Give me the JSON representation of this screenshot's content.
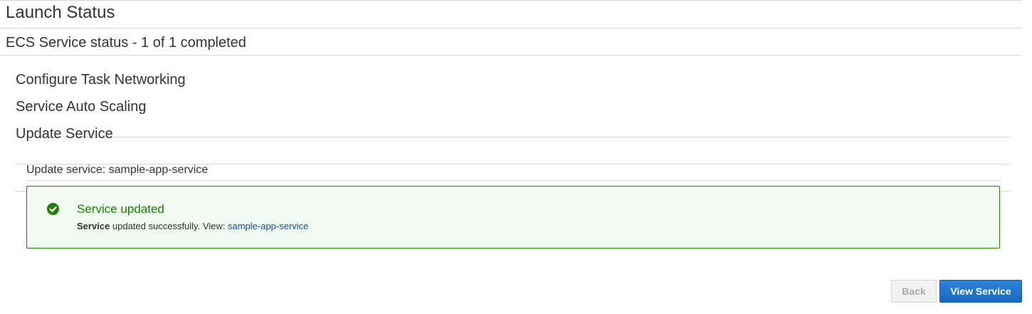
{
  "page": {
    "title": "Launch Status"
  },
  "status": {
    "title": "ECS Service status - 1 of 1 completed"
  },
  "steps": [
    {
      "label": "Configure Task Networking"
    },
    {
      "label": "Service Auto Scaling"
    },
    {
      "label": "Update Service"
    }
  ],
  "update": {
    "header": "Update service: sample-app-service",
    "alert": {
      "icon": "check-circle-icon",
      "title": "Service updated",
      "body_bold": "Service",
      "body_text": " updated successfully. View: ",
      "link": "sample-app-service",
      "color": "#1d8102"
    }
  },
  "actions": {
    "back_label": "Back",
    "view_label": "View Service",
    "primary_color": "#1668c2"
  }
}
